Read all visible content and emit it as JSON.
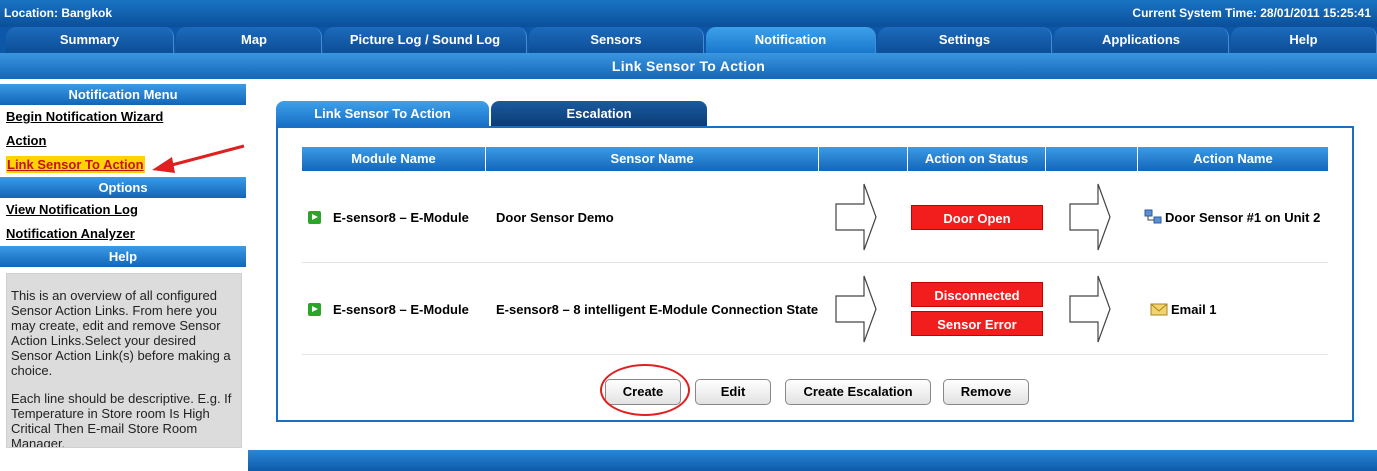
{
  "header": {
    "location": "Location: Bangkok",
    "time": "Current System Time: 28/01/2011 15:25:41"
  },
  "nav": {
    "tabs": [
      {
        "label": "Summary"
      },
      {
        "label": "Map"
      },
      {
        "label": "Picture Log / Sound Log"
      },
      {
        "label": "Sensors"
      },
      {
        "label": "Notification",
        "active": true
      },
      {
        "label": "Settings"
      },
      {
        "label": "Applications"
      },
      {
        "label": "Help"
      }
    ]
  },
  "page": {
    "title": "Link Sensor To Action"
  },
  "sidebar": {
    "menu_head": "Notification Menu",
    "menu": [
      "Begin Notification Wizard",
      "Action",
      "Link Sensor To Action"
    ],
    "options_head": "Options",
    "options": [
      "View Notification Log",
      "Notification Analyzer"
    ],
    "help_head": "Help",
    "help_text_1": "This is an overview of all configured Sensor Action Links. From here you may create, edit and remove Sensor Action Links.Select your desired Sensor Action Link(s) before making a choice.",
    "help_text_2": "Each line should be descriptive. E.g. If Temperature in Store room Is High Critical Then E-mail Store Room Manager."
  },
  "subtabs": [
    "Link Sensor To Action",
    "Escalation"
  ],
  "table": {
    "headers": [
      "Module Name",
      "Sensor Name",
      "",
      "Action on Status",
      "",
      "Action Name"
    ],
    "rows": [
      {
        "module": "E-sensor8 – E-Module",
        "sensor": "Door Sensor Demo",
        "statuses": [
          "Door Open"
        ],
        "action": "Door Sensor #1 on Unit 2",
        "action_icon": "network-icon"
      },
      {
        "module": "E-sensor8 – E-Module",
        "sensor": "E-sensor8 – 8 intelligent E-Module Connection State",
        "statuses": [
          "Disconnected",
          "Sensor Error"
        ],
        "action": "Email 1",
        "action_icon": "email-icon"
      }
    ]
  },
  "buttons": {
    "create": "Create",
    "edit": "Edit",
    "create_escalation": "Create Escalation",
    "remove": "Remove"
  },
  "colors": {
    "status_red": "#f21d1d",
    "header_blue": "#1466b9",
    "highlight_yellow": "#ffd400",
    "annotation_red": "#e02020"
  }
}
